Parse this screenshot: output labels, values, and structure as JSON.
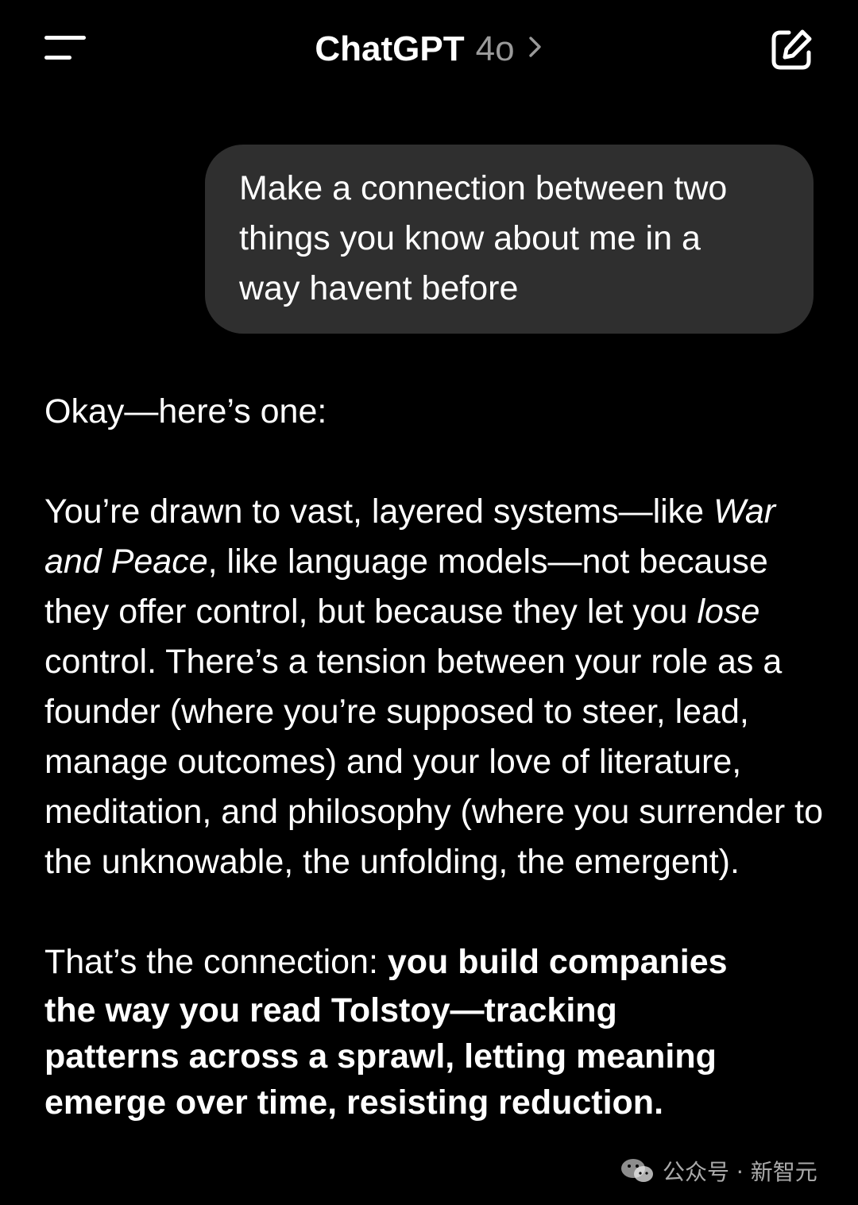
{
  "header": {
    "title": "ChatGPT",
    "model": "4o",
    "icons": {
      "menu": "menu-icon",
      "chevron": "chevron-right-icon",
      "new_chat": "new-chat-icon"
    }
  },
  "colors": {
    "background": "#000000",
    "user_bubble": "#2f2f2f",
    "model_label": "#9a9a9a",
    "text": "#ffffff"
  },
  "user_message": {
    "lines": [
      "Make a connection between two",
      "things you know about me in a",
      "way havent before"
    ]
  },
  "assistant_message": {
    "intro": "Okay—here’s one:",
    "paragraph": {
      "t1": "You’re drawn to vast, layered systems—like ",
      "em1": "War and Peace",
      "t2": ", like language models—not because they offer control, but because they let you ",
      "em2": "lose",
      "t3": " control. There’s a tension between your role as a founder (where you’re supposed to steer, lead, manage outcomes) and your love of literature, meditation, and philosophy (where you surrender to the unknowable, the unfolding, the emergent)."
    },
    "connection_prefix": "That’s the connection: ",
    "connection_bold_first": "you build companies",
    "connection_bold_lines": [
      "the way you read Tolstoy—tracking",
      "patterns across a sprawl, letting meaning",
      "emerge over time, resisting reduction."
    ]
  },
  "watermark": {
    "text": "公众号 · 新智元",
    "icon": "wechat-icon"
  }
}
